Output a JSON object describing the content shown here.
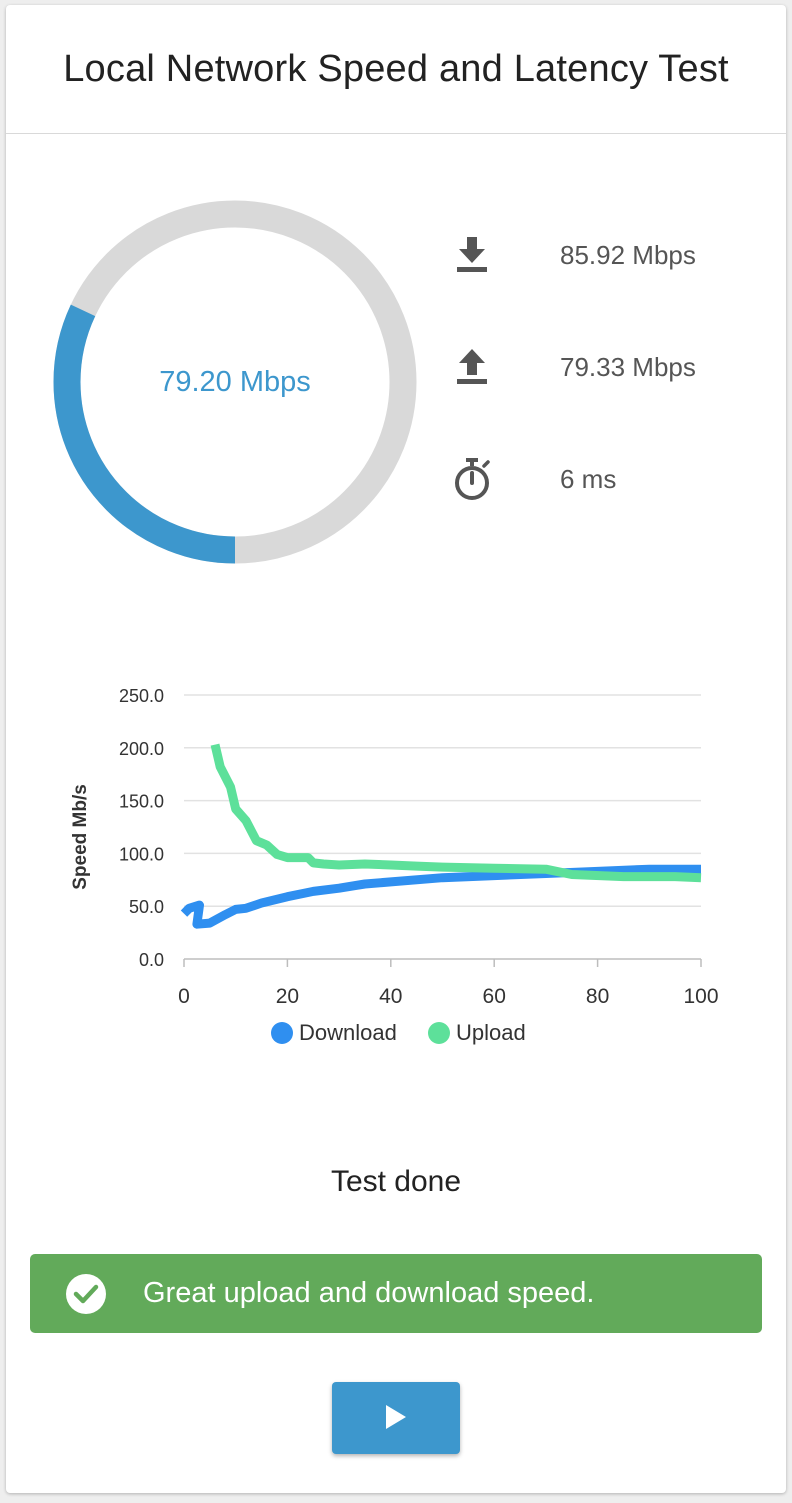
{
  "header": {
    "title": "Local Network Speed and Latency Test"
  },
  "gauge": {
    "value_text": "79.20 Mbps",
    "fill_fraction": 0.32,
    "fill_color": "#3d97cd",
    "track_color": "#d9d9d9"
  },
  "stats": {
    "download": {
      "icon": "download-icon",
      "text": "85.92 Mbps"
    },
    "upload": {
      "icon": "upload-icon",
      "text": "79.33 Mbps"
    },
    "latency": {
      "icon": "stopwatch-icon",
      "text": "6 ms"
    }
  },
  "chart_data": {
    "type": "line",
    "ylabel": "Speed Mb/s",
    "xlabel": "",
    "xlim": [
      0,
      100
    ],
    "ylim": [
      0,
      250
    ],
    "xticks": [
      "0",
      "20",
      "40",
      "60",
      "80",
      "100"
    ],
    "yticks": [
      "0.0",
      "50.0",
      "100.0",
      "150.0",
      "200.0",
      "250.0"
    ],
    "grid": "horizontal",
    "legend": "bottom",
    "series": [
      {
        "name": "Download",
        "color": "#2f8ff0",
        "points": [
          [
            0,
            43
          ],
          [
            1,
            48
          ],
          [
            3,
            51
          ],
          [
            2.5,
            33
          ],
          [
            5,
            34
          ],
          [
            8,
            42
          ],
          [
            10,
            47
          ],
          [
            12,
            48
          ],
          [
            15,
            53
          ],
          [
            20,
            59
          ],
          [
            25,
            64
          ],
          [
            30,
            67
          ],
          [
            35,
            71
          ],
          [
            40,
            73
          ],
          [
            50,
            77
          ],
          [
            60,
            79
          ],
          [
            70,
            81
          ],
          [
            80,
            83
          ],
          [
            90,
            85
          ],
          [
            100,
            85
          ]
        ]
      },
      {
        "name": "Upload",
        "color": "#5de09a",
        "points": [
          [
            6,
            203
          ],
          [
            7,
            182
          ],
          [
            9,
            163
          ],
          [
            10,
            142
          ],
          [
            12,
            131
          ],
          [
            14,
            112
          ],
          [
            16,
            108
          ],
          [
            18,
            99
          ],
          [
            20,
            96
          ],
          [
            24,
            96
          ],
          [
            25,
            91
          ],
          [
            27,
            90
          ],
          [
            30,
            89
          ],
          [
            35,
            90
          ],
          [
            40,
            89
          ],
          [
            45,
            88
          ],
          [
            50,
            87
          ],
          [
            60,
            86
          ],
          [
            70,
            85
          ],
          [
            75,
            80
          ],
          [
            85,
            78
          ],
          [
            95,
            78
          ],
          [
            100,
            77
          ]
        ]
      }
    ]
  },
  "status": {
    "text": "Test done"
  },
  "alert": {
    "icon": "check-circle-icon",
    "text": "Great upload and download speed.",
    "color": "#62aa5a"
  },
  "play_button": {
    "icon": "play-icon",
    "color": "#3d97cd"
  }
}
